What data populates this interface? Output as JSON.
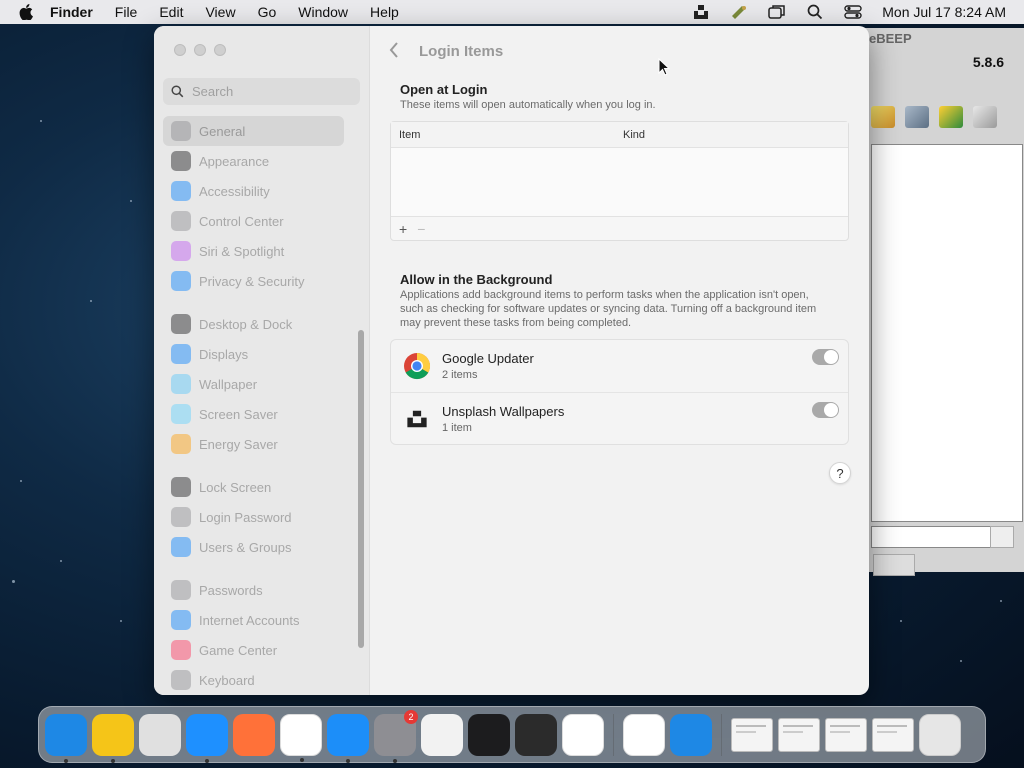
{
  "menubar": {
    "items": [
      "Finder",
      "File",
      "Edit",
      "View",
      "Go",
      "Window",
      "Help"
    ],
    "status_icons": [
      "unsplash-icon",
      "pen-tool-icon",
      "screens-icon",
      "spotlight-search-icon",
      "control-center-icon"
    ],
    "clock": "Mon Jul 17  8:24 AM"
  },
  "background_app": {
    "title_fragment": "eBEEP",
    "version": "5.8.6"
  },
  "settings": {
    "search_placeholder": "Search",
    "sidebar": {
      "group1": [
        {
          "label": "General",
          "icon": "gear-icon",
          "color": "#8e8e93",
          "selected": true
        },
        {
          "label": "Appearance",
          "icon": "appearance-icon",
          "color": "#1c1c1e"
        },
        {
          "label": "Accessibility",
          "icon": "accessibility-icon",
          "color": "#0a84ff"
        },
        {
          "label": "Control Center",
          "icon": "control-center-icon",
          "color": "#8e8e93"
        },
        {
          "label": "Siri & Spotlight",
          "icon": "siri-icon",
          "color": "#bf5af2"
        },
        {
          "label": "Privacy & Security",
          "icon": "hand-icon",
          "color": "#0a84ff"
        }
      ],
      "group2": [
        {
          "label": "Desktop & Dock",
          "icon": "dock-icon",
          "color": "#1c1c1e"
        },
        {
          "label": "Displays",
          "icon": "sun-icon",
          "color": "#0a84ff"
        },
        {
          "label": "Wallpaper",
          "icon": "wallpaper-icon",
          "color": "#5ac8fa"
        },
        {
          "label": "Screen Saver",
          "icon": "screen-saver-icon",
          "color": "#64d2ff"
        },
        {
          "label": "Energy Saver",
          "icon": "battery-icon",
          "color": "#ff9f0a"
        }
      ],
      "group3": [
        {
          "label": "Lock Screen",
          "icon": "lock-icon",
          "color": "#1c1c1e"
        },
        {
          "label": "Login Password",
          "icon": "key-icon",
          "color": "#8e8e93"
        },
        {
          "label": "Users & Groups",
          "icon": "users-icon",
          "color": "#0a84ff"
        }
      ],
      "group4": [
        {
          "label": "Passwords",
          "icon": "password-key-icon",
          "color": "#8e8e93"
        },
        {
          "label": "Internet Accounts",
          "icon": "at-icon",
          "color": "#0a84ff"
        },
        {
          "label": "Game Center",
          "icon": "game-center-icon",
          "color": "#ff375f"
        },
        {
          "label": "Keyboard",
          "icon": "keyboard-icon",
          "color": "#8e8e93"
        }
      ]
    },
    "page_title": "Login Items",
    "open_at_login": {
      "title": "Open at Login",
      "subtitle": "These items will open automatically when you log in.",
      "columns": [
        "Item",
        "Kind"
      ],
      "add_label": "+",
      "remove_label": "−"
    },
    "allow_background": {
      "title": "Allow in the Background",
      "subtitle": "Applications add background items to perform tasks when the application isn't open, such as checking for software updates or syncing data. Turning off a background item may prevent these tasks from being completed.",
      "items": [
        {
          "name": "Google Updater",
          "count": "2 items",
          "icon": "chrome-icon",
          "enabled": true
        },
        {
          "name": "Unsplash Wallpapers",
          "count": "1 item",
          "icon": "unsplash-icon",
          "enabled": true
        }
      ]
    },
    "help_label": "?"
  },
  "dock": {
    "apps": [
      {
        "name": "finder-icon",
        "color": "#1e88e5",
        "running": true
      },
      {
        "name": "bee-app-icon",
        "color": "#f5c518",
        "running": true
      },
      {
        "name": "launchpad-icon",
        "color": "#e0e0e0",
        "running": false
      },
      {
        "name": "safari-icon",
        "color": "#1e90ff",
        "running": true
      },
      {
        "name": "firefox-icon",
        "color": "#ff7139",
        "running": false
      },
      {
        "name": "chrome-icon",
        "color": "#ffffff",
        "running": true
      },
      {
        "name": "app-store-icon",
        "color": "#1c8ef9",
        "running": true
      },
      {
        "name": "system-settings-icon",
        "color": "#8e8e93",
        "running": true,
        "badge": "2"
      },
      {
        "name": "textedit-icon",
        "color": "#f2f2f2",
        "running": false
      },
      {
        "name": "terminal-icon",
        "color": "#1c1c1e",
        "running": false
      },
      {
        "name": "garageband-icon",
        "color": "#2b2b2b",
        "running": false
      },
      {
        "name": "vscode-icon",
        "color": "#ffffff",
        "running": false
      }
    ],
    "apps2": [
      {
        "name": "visual-studio-icon",
        "color": "#ffffff"
      },
      {
        "name": "weather-icon",
        "color": "#1e88e5"
      }
    ]
  }
}
